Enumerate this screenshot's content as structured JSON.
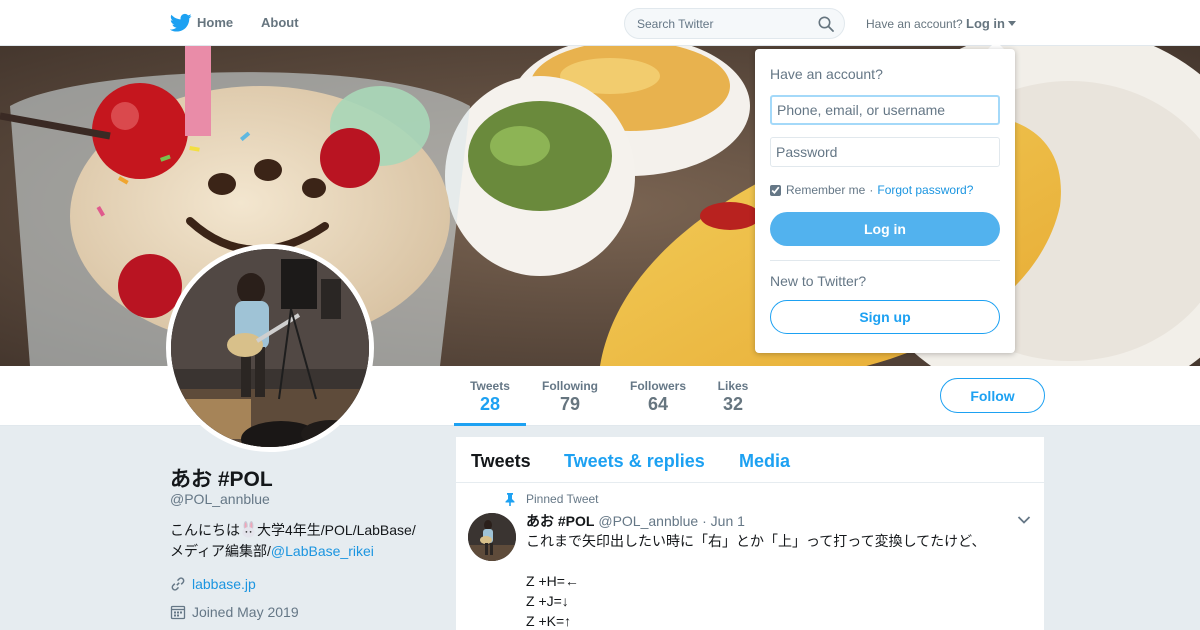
{
  "nav": {
    "home_label": "Home",
    "about_label": "About",
    "search_placeholder": "Search Twitter",
    "account_question": "Have an account?",
    "login_label": "Log in"
  },
  "stats": {
    "tweets_label": "Tweets",
    "tweets_count": "28",
    "following_label": "Following",
    "following_count": "79",
    "followers_label": "Followers",
    "followers_count": "64",
    "likes_label": "Likes",
    "likes_count": "32",
    "active_tab": "Tweets"
  },
  "follow_label": "Follow",
  "profile": {
    "name": "あお #POL",
    "handle": "@POL_annblue",
    "bio_line1": "こんにちは",
    "bio_line1_rest": "大学4年生/POL/LabBase/",
    "bio_line2": "メディア編集部/",
    "bio_mention": "@LabBase_rikei",
    "website": "labbase.jp",
    "joined": "Joined May 2019"
  },
  "timeline": {
    "tabs": [
      "Tweets",
      "Tweets & replies",
      "Media"
    ],
    "active_tab": "Tweets",
    "pinned_label": "Pinned Tweet",
    "tweet": {
      "name": "あお #POL",
      "handle": "@POL_annblue",
      "separator": "·",
      "date": "Jun 1",
      "lines": [
        "これまで矢印出したい時に「右」とか「上」って打って変換してたけど、",
        "",
        "Z +H=←",
        "Z +J=↓",
        "Z +K=↑"
      ]
    }
  },
  "login_dropdown": {
    "question": "Have an account?",
    "username_placeholder": "Phone, email, or username",
    "password_placeholder": "Password",
    "remember_label": "Remember me",
    "remember_checked": true,
    "separator": "·",
    "forgot_label": "Forgot password?",
    "login_button": "Log in",
    "new_question": "New to Twitter?",
    "signup_button": "Sign up"
  },
  "colors": {
    "accent": "#1da1f2",
    "login_button": "#52b2ee",
    "link": "#1b95e0",
    "background": "#e6ecf0"
  }
}
